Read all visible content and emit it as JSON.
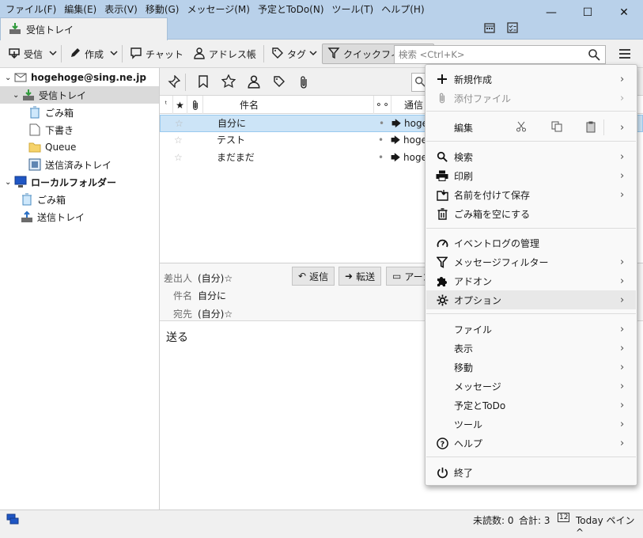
{
  "menubar": [
    "ファイル(F)",
    "編集(E)",
    "表示(V)",
    "移動(G)",
    "メッセージ(M)",
    "予定とToDo(N)",
    "ツール(T)",
    "ヘルプ(H)"
  ],
  "window": {
    "minimize": "—",
    "maximize": "☐",
    "close": "✕"
  },
  "tab": {
    "label": "受信トレイ"
  },
  "toolbar": {
    "get_mail": "受信",
    "write": "作成",
    "chat": "チャット",
    "address_book": "アドレス帳",
    "tag": "タグ",
    "quick_filter": "クイックフィルター",
    "search_placeholder": "検索 <Ctrl+K>"
  },
  "folders": [
    {
      "label": "hogehoge@sing.ne.jp",
      "icon": "account-icon",
      "bold": true
    },
    {
      "label": "受信トレイ",
      "icon": "inbox-icon"
    },
    {
      "label": "ごみ箱",
      "icon": "trash-icon"
    },
    {
      "label": "下書き",
      "icon": "drafts-icon"
    },
    {
      "label": "Queue",
      "icon": "folder-icon"
    },
    {
      "label": "送信済みトレイ",
      "icon": "sent-icon"
    },
    {
      "label": "ローカルフォルダー",
      "icon": "local-folders-icon",
      "bold": true
    },
    {
      "label": "ごみ箱",
      "icon": "trash-icon"
    },
    {
      "label": "送信トレイ",
      "icon": "outbox-icon"
    }
  ],
  "list_columns": {
    "subject": "件名",
    "correspondent": "通信"
  },
  "messages": [
    {
      "subject": "自分に",
      "correspondent": "hoge"
    },
    {
      "subject": "テスト",
      "correspondent": "hoge"
    },
    {
      "subject": "まだまだ",
      "correspondent": "hoge"
    }
  ],
  "message_header": {
    "from_label": "差出人",
    "from_value": "(自分)",
    "subject_label": "件名",
    "subject_value": "自分に",
    "to_label": "宛先",
    "to_value": "(自分)",
    "reply": "返信",
    "forward": "転送",
    "archive": "アーカ"
  },
  "message_body": "送る",
  "statusbar": {
    "unread": "未読数: 0",
    "total": "合計: 3",
    "today_pane": "Today ペイン"
  },
  "app_menu": {
    "items": [
      {
        "label": "新規作成",
        "icon": "plus-icon",
        "submenu": true
      },
      {
        "label": "添付ファイル",
        "icon": "paperclip-icon",
        "submenu": true,
        "disabled": true
      },
      {
        "label": "編集",
        "icon": "",
        "submenu": true
      },
      {
        "label": "検索",
        "icon": "search-icon",
        "submenu": true
      },
      {
        "label": "印刷",
        "icon": "print-icon",
        "submenu": true
      },
      {
        "label": "名前を付けて保存",
        "icon": "save-icon",
        "submenu": true
      },
      {
        "label": "ごみ箱を空にする",
        "icon": "trash-icon",
        "submenu": false
      },
      {
        "label": "イベントログの管理",
        "icon": "gauge-icon",
        "submenu": false
      },
      {
        "label": "メッセージフィルター",
        "icon": "filter-icon",
        "submenu": true
      },
      {
        "label": "アドオン",
        "icon": "puzzle-icon",
        "submenu": true
      },
      {
        "label": "オプション",
        "icon": "gear-icon",
        "submenu": true
      },
      {
        "label": "ファイル",
        "icon": "",
        "submenu": true
      },
      {
        "label": "表示",
        "icon": "",
        "submenu": true
      },
      {
        "label": "移動",
        "icon": "",
        "submenu": true
      },
      {
        "label": "メッセージ",
        "icon": "",
        "submenu": true
      },
      {
        "label": "予定とToDo",
        "icon": "",
        "submenu": true
      },
      {
        "label": "ツール",
        "icon": "",
        "submenu": true
      },
      {
        "label": "ヘルプ",
        "icon": "help-icon",
        "submenu": true
      },
      {
        "label": "終了",
        "icon": "power-icon",
        "submenu": false
      }
    ]
  }
}
